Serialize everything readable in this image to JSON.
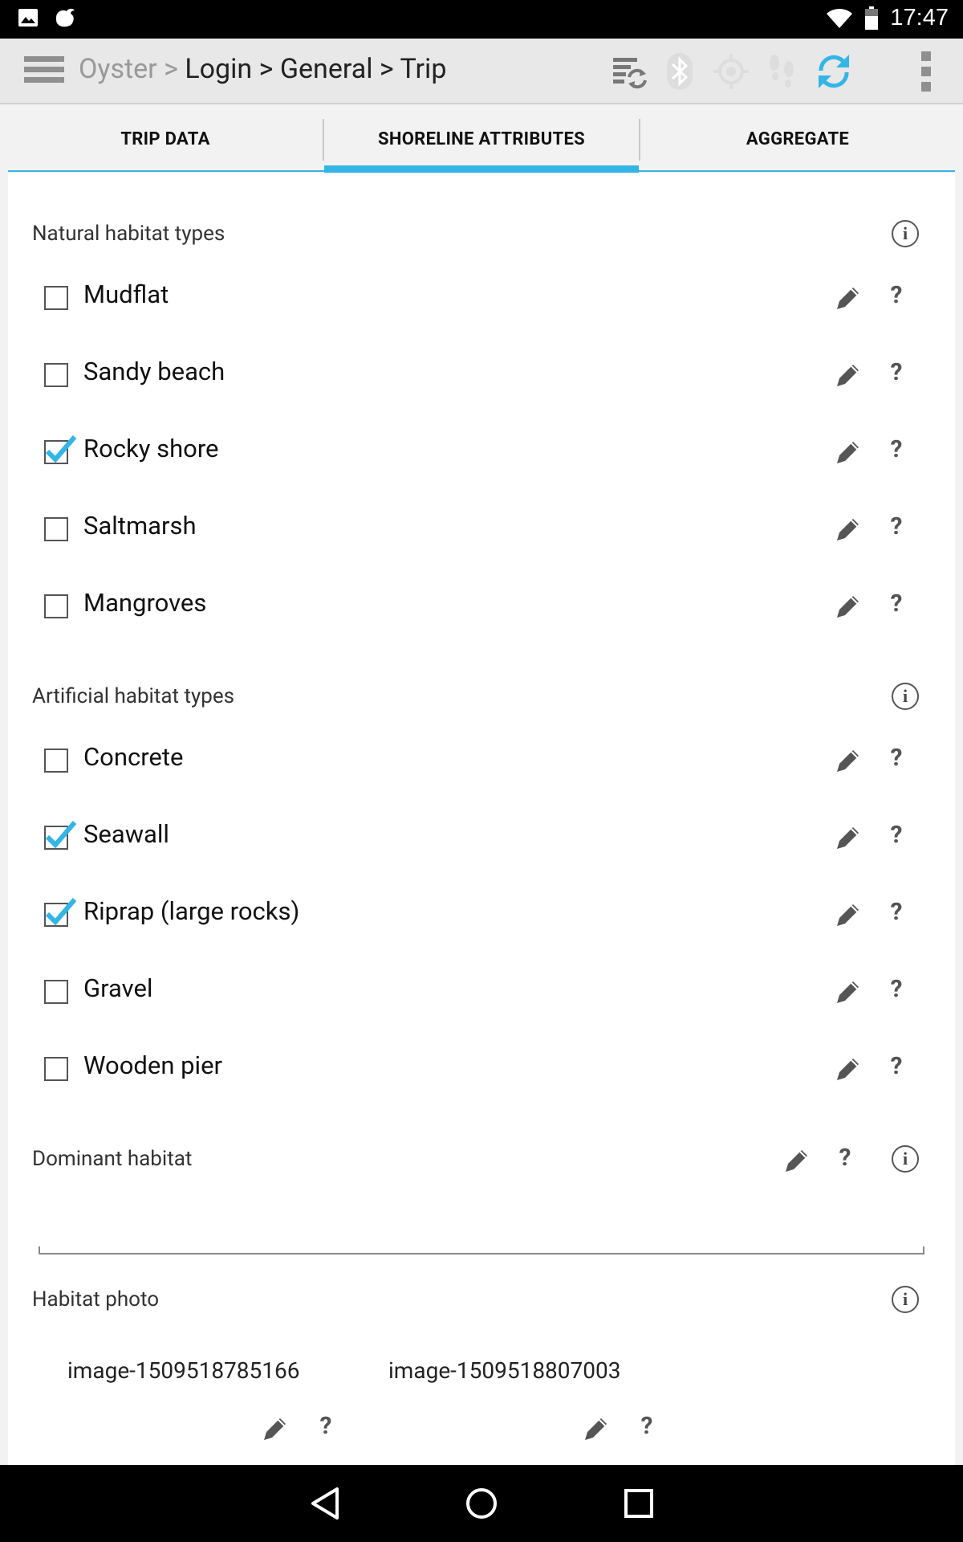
{
  "status_bar": {
    "time": "17:47",
    "left_icons": [
      "image-icon",
      "notification-app-icon"
    ],
    "right_icons": [
      "wifi-icon",
      "battery-icon"
    ]
  },
  "action_bar": {
    "breadcrumb": {
      "root": "Oyster",
      "separator": ">",
      "items": [
        "Login",
        "General",
        "Trip"
      ]
    },
    "icons": [
      "sync-list-icon",
      "bluetooth-icon",
      "gps-icon",
      "footprints-icon",
      "refresh-icon",
      "overflow-menu-icon"
    ],
    "accent_color": "#33b5e5"
  },
  "tabs": [
    {
      "label": "TRIP DATA",
      "selected": false
    },
    {
      "label": "SHORELINE ATTRIBUTES",
      "selected": true
    },
    {
      "label": "AGGREGATE",
      "selected": false
    }
  ],
  "natural": {
    "title": "Natural habitat types",
    "items": [
      {
        "label": "Mudflat",
        "checked": false
      },
      {
        "label": "Sandy beach",
        "checked": false
      },
      {
        "label": "Rocky shore",
        "checked": true
      },
      {
        "label": "Saltmarsh",
        "checked": false
      },
      {
        "label": "Mangroves",
        "checked": false
      }
    ]
  },
  "artificial": {
    "title": "Artificial habitat types",
    "items": [
      {
        "label": "Concrete",
        "checked": false
      },
      {
        "label": "Seawall",
        "checked": true
      },
      {
        "label": "Riprap (large rocks)",
        "checked": true
      },
      {
        "label": "Gravel",
        "checked": false
      },
      {
        "label": "Wooden pier",
        "checked": false
      }
    ]
  },
  "dominant": {
    "title": "Dominant habitat",
    "value": ""
  },
  "photo": {
    "title": "Habitat photo",
    "images": [
      "image-1509518785166",
      "image-1509518807003"
    ]
  },
  "common": {
    "help_glyph": "?",
    "info_glyph": "i"
  },
  "navigation": [
    "back-icon",
    "home-icon",
    "recents-icon"
  ]
}
